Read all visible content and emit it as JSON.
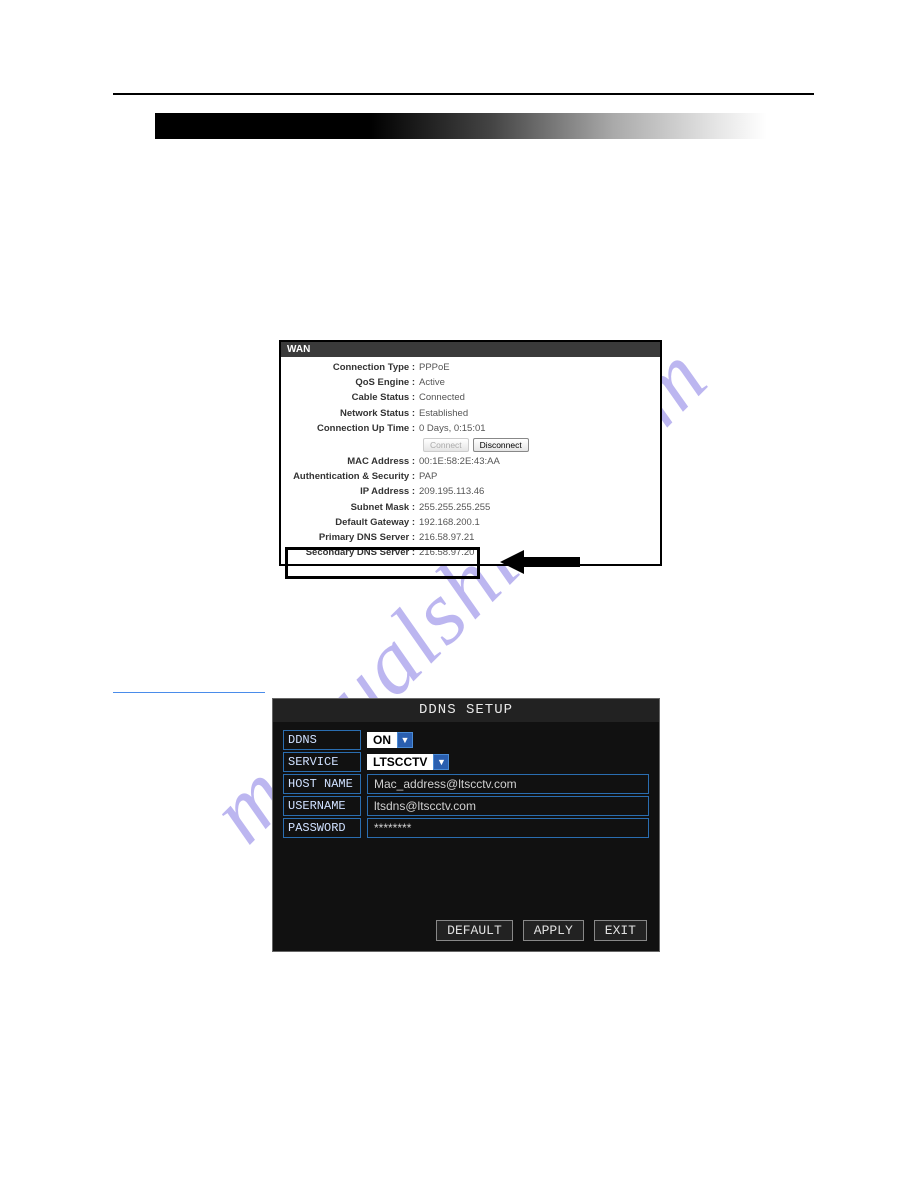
{
  "watermark": "manualshive.com",
  "wan": {
    "header": "WAN",
    "rows": [
      {
        "label": "Connection Type :",
        "value": "PPPoE"
      },
      {
        "label": "QoS Engine :",
        "value": "Active"
      },
      {
        "label": "Cable Status :",
        "value": "Connected"
      },
      {
        "label": "Network Status :",
        "value": "Established"
      },
      {
        "label": "Connection Up Time :",
        "value": "0 Days, 0:15:01"
      }
    ],
    "connect_btn": "Connect",
    "disconnect_btn": "Disconnect",
    "rows2": [
      {
        "label": "MAC Address :",
        "value": "00:1E:58:2E:43:AA"
      },
      {
        "label": "Authentication & Security :",
        "value": "PAP"
      },
      {
        "label": "IP Address :",
        "value": "209.195.113.46"
      },
      {
        "label": "Subnet Mask :",
        "value": "255.255.255.255"
      },
      {
        "label": "Default Gateway :",
        "value": "192.168.200.1"
      },
      {
        "label": "Primary DNS Server :",
        "value": "216.58.97.21"
      },
      {
        "label": "Secondary DNS Server :",
        "value": "216.58.97.20"
      }
    ]
  },
  "ddns": {
    "title": "DDNS SETUP",
    "fields": {
      "ddns_label": "DDNS",
      "ddns_value": "ON",
      "service_label": "SERVICE",
      "service_value": "LTSCCTV",
      "host_label": "HOST NAME",
      "host_value": "Mac_address@ltscctv.com",
      "user_label": "USERNAME",
      "user_value": "ltsdns@ltscctv.com",
      "pass_label": "PASSWORD",
      "pass_value": "********"
    },
    "buttons": {
      "default": "DEFAULT",
      "apply": "APPLY",
      "exit": "EXIT"
    }
  }
}
